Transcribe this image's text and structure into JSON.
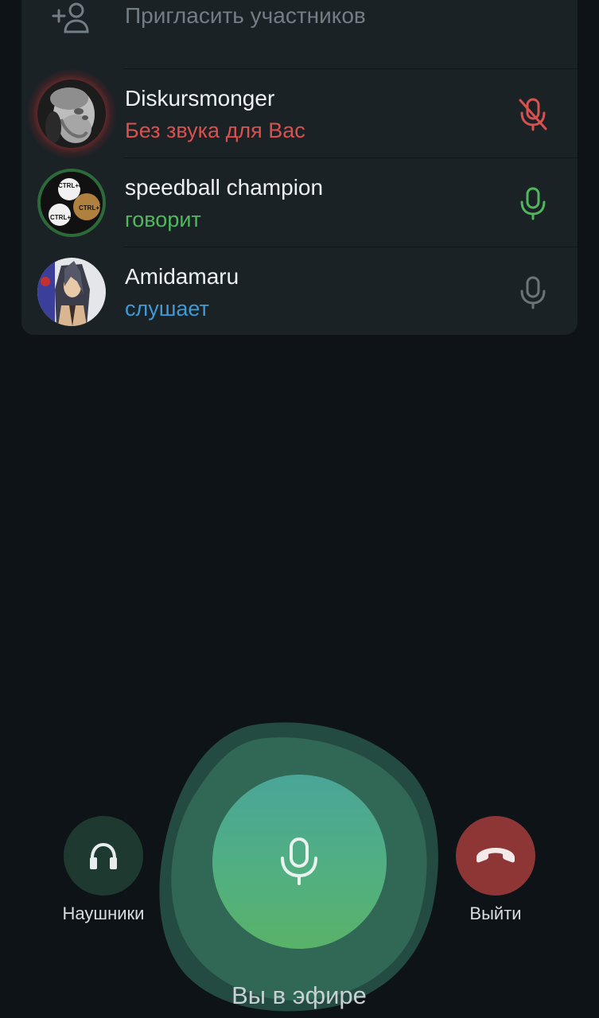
{
  "invite": {
    "label": "Пригласить участников",
    "icon": "add-user-icon"
  },
  "members": [
    {
      "name": "Diskursmonger",
      "status": "Без звука для Вас",
      "status_color": "#d9514f",
      "mic_state": "muted",
      "mic_icon": "mic-off-icon",
      "mic_color": "#d9514f"
    },
    {
      "name": "speedball champion",
      "status": "говорит",
      "status_color": "#4fb85c",
      "mic_state": "speaking",
      "mic_icon": "mic-icon",
      "mic_color": "#4fb85c"
    },
    {
      "name": "Amidamaru",
      "status": "слушает",
      "status_color": "#3d9ad6",
      "mic_state": "listening",
      "mic_icon": "mic-icon",
      "mic_color": "#6a7479"
    }
  ],
  "controls": {
    "headphones_label": "Наушники",
    "headphones_icon": "headphones-icon",
    "leave_label": "Выйти",
    "leave_icon": "hang-up-icon",
    "mic_icon": "mic-icon",
    "status_text": "Вы в эфире"
  },
  "colors": {
    "background": "#0d1316",
    "panel": "#1b2226",
    "mic_button": "#52b07f",
    "headphones_button": "#1e3a30",
    "leave_button": "#8e3636"
  }
}
